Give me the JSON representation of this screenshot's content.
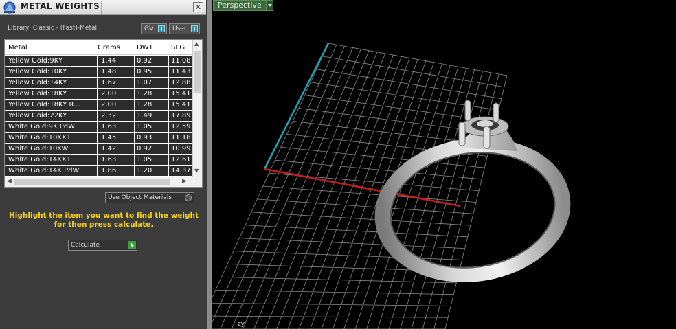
{
  "panel": {
    "title": "METAL WEIGHTS",
    "close_glyph": "✕",
    "library_label": "Library: Classic - (Fast)-Metal",
    "toggles": [
      {
        "label": "GV"
      },
      {
        "label": "User"
      }
    ],
    "table": {
      "columns": [
        "Metal",
        "Grams",
        "DWT",
        "SPG"
      ],
      "rows": [
        {
          "metal": "Yellow Gold:9KY",
          "grams": "1.44",
          "dwt": "0.92",
          "spg": "11.08"
        },
        {
          "metal": "Yellow Gold:10KY",
          "grams": "1.48",
          "dwt": "0.95",
          "spg": "11.43"
        },
        {
          "metal": "Yellow Gold:14KY",
          "grams": "1.67",
          "dwt": "1.07",
          "spg": "12.88"
        },
        {
          "metal": "Yellow Gold:18KY",
          "grams": "2.00",
          "dwt": "1.28",
          "spg": "15.41"
        },
        {
          "metal": "Yellow Gold:18KY R...",
          "grams": "2.00",
          "dwt": "1.28",
          "spg": "15.41"
        },
        {
          "metal": "Yellow Gold:22KY",
          "grams": "2.32",
          "dwt": "1.49",
          "spg": "17.89"
        },
        {
          "metal": "White Gold:9K PdW",
          "grams": "1.63",
          "dwt": "1.05",
          "spg": "12.59"
        },
        {
          "metal": "White Gold:10KX1",
          "grams": "1.45",
          "dwt": "0.93",
          "spg": "11.18"
        },
        {
          "metal": "White Gold:10KW",
          "grams": "1.42",
          "dwt": "0.92",
          "spg": "10.99"
        },
        {
          "metal": "White Gold:14KX1",
          "grams": "1.63",
          "dwt": "1.05",
          "spg": "12.61"
        },
        {
          "metal": "White Gold:14K PdW",
          "grams": "1.86",
          "dwt": "1.20",
          "spg": "14.37"
        }
      ]
    },
    "use_object_materials_label": "Use Object Materials",
    "instructions": "Highlight the item you want to find the weight for then press calculate.",
    "calculate_label": "Calculate"
  },
  "viewport": {
    "label": "Perspective",
    "axis_indicator": "zy"
  },
  "colors": {
    "instruction_text": "#f5d21c",
    "viewport_label_bg": "#3a6b3a",
    "axis_x": "#c8201c",
    "axis_y": "#1aa6b4",
    "grid": "#8a8a8a"
  }
}
